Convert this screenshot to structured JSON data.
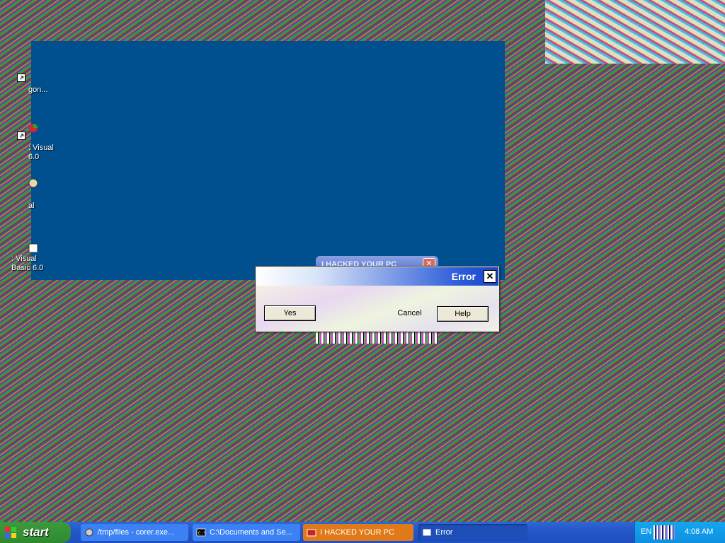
{
  "desktop": {
    "icons": [
      {
        "label": "gon..."
      },
      {
        "label": ": Visual\n6.0"
      },
      {
        "label": "al"
      },
      {
        "label": ": Visual\nBasic 6.0"
      }
    ]
  },
  "ghost_window": {
    "title": "I HACKED YOUR PC"
  },
  "dialog": {
    "title": "Error",
    "buttons": {
      "yes": "Yes",
      "cancel": "Cancel",
      "help": "Help"
    },
    "close_glyph": "✕"
  },
  "taskbar": {
    "start_label": "start",
    "tasks": [
      {
        "label": "/tmp/files - corer.exe..."
      },
      {
        "label": "C:\\Documents and Se..."
      },
      {
        "label": "I HACKED YOUR PC"
      },
      {
        "label": "Error"
      }
    ],
    "language": "EN",
    "clock": "4:08 AM"
  },
  "colors": {
    "taskbar": "#2457c9",
    "start": "#2f8a2f",
    "active_task": "#e07a18",
    "window_blue": "#00508f"
  }
}
